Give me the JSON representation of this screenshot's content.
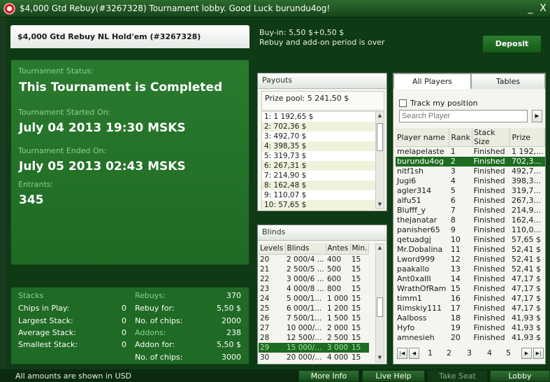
{
  "window": {
    "title": "$4,000 Gtd Rebuy(#3267328) Tournament lobby. Good Luck burundu4og!",
    "minimize": "_",
    "close": "X"
  },
  "header": {
    "name": "$4,000 Gtd Rebuy NL Hold'em (#3267328)"
  },
  "status": {
    "status_label": "Tournament Status:",
    "status_value": "This Tournament is Completed",
    "started_label": "Tournament Started On:",
    "started_value": "July 04 2013  19:30 MSKS",
    "ended_label": "Tournament Ended On:",
    "ended_value": "July 05 2013  02:43 MSKS",
    "entrants_label": "Entrants:",
    "entrants_value": "345"
  },
  "stats": {
    "stacks_label": "Stacks",
    "chips_in_play_label": "Chips in Play:",
    "chips_in_play": "0",
    "largest_label": "Largest Stack:",
    "largest": "0",
    "average_label": "Average Stack:",
    "average": "0",
    "smallest_label": "Smallest Stack:",
    "smallest": "0",
    "rebuys_label": "Rebuys:",
    "rebuys": "370",
    "rebuy_for_label": "Rebuy for:",
    "rebuy_for": "5,50 $",
    "rebuy_chips_label": "No. of chips:",
    "rebuy_chips": "2000",
    "addons_label": "Addons:",
    "addons": "238",
    "addon_for_label": "Addon for:",
    "addon_for": "5,50 $",
    "addon_chips_label": "No. of chips:",
    "addon_chips": "3000"
  },
  "buyin": {
    "line1": "Buy-in: 5,50 $+0,50 $",
    "line2": "Rebuy and add-on period is over"
  },
  "deposit_label": "Deposit",
  "payouts": {
    "title": "Payouts",
    "prize_pool": "Prize pool: 5 241,50 $",
    "rows": [
      "1: 1 192,65 $",
      "2: 702,36 $",
      "3: 492,70 $",
      "4: 398,35 $",
      "5: 319,73 $",
      "6: 267,31 $",
      "7: 214,90 $",
      "8: 162,48 $",
      "9: 110,07 $",
      "10: 57,65 $"
    ]
  },
  "blinds": {
    "title": "Blinds",
    "columns": [
      "Levels",
      "Blinds",
      "Antes",
      "Min."
    ],
    "rows": [
      [
        "20",
        "2 000/4 ...",
        "400",
        "15"
      ],
      [
        "21",
        "2 500/5 ...",
        "500",
        "15"
      ],
      [
        "22",
        "3 000/6 ...",
        "600",
        "15"
      ],
      [
        "23",
        "4 000/8 ...",
        "800",
        "15"
      ],
      [
        "24",
        "5 000/1...",
        "1 000",
        "15"
      ],
      [
        "25",
        "6 000/1...",
        "1 200",
        "15"
      ],
      [
        "26",
        "7 500/1...",
        "1 500",
        "15"
      ],
      [
        "27",
        "10 000/...",
        "2 000",
        "15"
      ],
      [
        "28",
        "12 500/...",
        "2 500",
        "15"
      ],
      [
        "29",
        "15 000/...",
        "3 000",
        "15"
      ],
      [
        "30",
        "20 000/...",
        "4 000",
        "15"
      ]
    ],
    "highlight_index": 9
  },
  "players": {
    "tab_all": "All Players",
    "tab_tables": "Tables",
    "track_label": "Track my position",
    "search_placeholder": "Search Player",
    "columns": [
      "Player name",
      "Rank",
      "Stack Size",
      "Prize"
    ],
    "rows": [
      [
        "melapelaste",
        "1",
        "Finished",
        "1 192,..."
      ],
      [
        "burundu4og",
        "2",
        "Finished",
        "702,3..."
      ],
      [
        "nitf1sh",
        "3",
        "Finished",
        "492,7..."
      ],
      [
        "Jugi6",
        "4",
        "Finished",
        "398,3..."
      ],
      [
        "agler314",
        "5",
        "Finished",
        "319,7..."
      ],
      [
        "alfu51",
        "6",
        "Finished",
        "267,3..."
      ],
      [
        "Blufff_y",
        "7",
        "Finished",
        "214,9..."
      ],
      [
        "thejanatar",
        "8",
        "Finished",
        "162,4..."
      ],
      [
        "panisher65",
        "9",
        "Finished",
        "110,0..."
      ],
      [
        "qetuadgj",
        "10",
        "Finished",
        "57,65 $"
      ],
      [
        "Mr.Dobalina",
        "11",
        "Finished",
        "52,41 $"
      ],
      [
        "Lword999",
        "12",
        "Finished",
        "52,41 $"
      ],
      [
        "paakallo",
        "13",
        "Finished",
        "52,41 $"
      ],
      [
        "Ant0xaIII",
        "14",
        "Finished",
        "47,17 $"
      ],
      [
        "WrathOfRam",
        "15",
        "Finished",
        "47,17 $"
      ],
      [
        "timm1",
        "16",
        "Finished",
        "47,17 $"
      ],
      [
        "Rimskiy111",
        "17",
        "Finished",
        "47,17 $"
      ],
      [
        "Aalboss",
        "18",
        "Finished",
        "41,93 $"
      ],
      [
        "Hyfo",
        "19",
        "Finished",
        "41,93 $"
      ],
      [
        "amnesieh",
        "20",
        "Finished",
        "41,93 $"
      ]
    ],
    "highlight_index": 1,
    "pages": [
      "1",
      "2",
      "3",
      "4",
      "5"
    ]
  },
  "statusbar": {
    "note": "All amounts are shown in USD",
    "more_info": "More Info",
    "live_help": "Live Help",
    "take_seat": "Take Seat",
    "lobby": "Lobby"
  },
  "colors": {
    "accent": "#1e6b22",
    "panel_green": "#1f6a24",
    "label_green": "#8ed08f"
  },
  "icons": [
    "logo-icon",
    "minimize-icon",
    "close-icon",
    "arrow-up-icon",
    "arrow-down-icon",
    "arrow-right-icon",
    "first-page-icon",
    "prev-page-icon",
    "next-page-icon",
    "last-page-icon"
  ]
}
